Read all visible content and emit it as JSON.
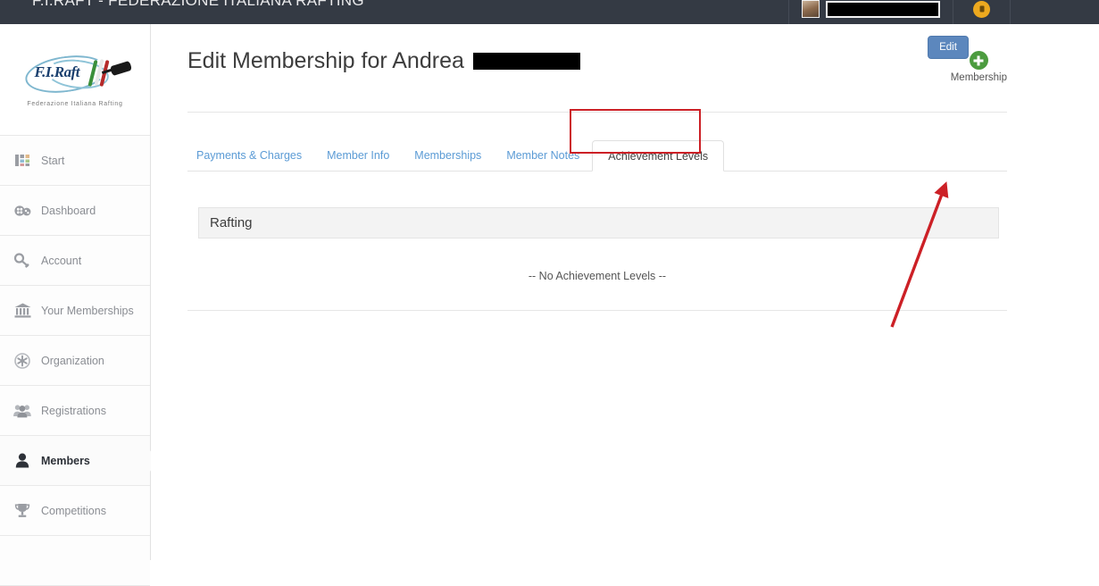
{
  "topbar": {
    "title": "F.I.RAFT - FEDERAZIONE ITALIANA RAFTING",
    "background_color": "#343a44",
    "avatar_icon": "user-avatar-photo",
    "username_redacted": "",
    "notification_icon": "bell-icon",
    "notification_color": "#eda91f"
  },
  "sidebar": {
    "logo": {
      "brand": "F.I.Raft",
      "tagline": "Federazione Italiana Rafting"
    },
    "items": [
      {
        "label": "Start",
        "icon": "grid-icon",
        "active": false
      },
      {
        "label": "Dashboard",
        "icon": "gauge-icon",
        "active": false
      },
      {
        "label": "Account",
        "icon": "key-icon",
        "active": false
      },
      {
        "label": "Your Memberships",
        "icon": "bank-icon",
        "active": false
      },
      {
        "label": "Organization",
        "icon": "asterisk-gear-icon",
        "active": false
      },
      {
        "label": "Registrations",
        "icon": "people-icon",
        "active": false
      },
      {
        "label": "Members",
        "icon": "person-icon",
        "active": true
      },
      {
        "label": "Competitions",
        "icon": "trophy-icon",
        "active": false
      }
    ]
  },
  "main": {
    "page_title": "Edit Membership for Andrea",
    "title_redacted": true,
    "add_membership": {
      "icon": "plus-circle-icon",
      "label": "Membership",
      "color": "#4c9c3f"
    },
    "tabs": [
      {
        "label": "Payments & Charges",
        "active": false
      },
      {
        "label": "Member Info",
        "active": false
      },
      {
        "label": "Memberships",
        "active": false
      },
      {
        "label": "Member Notes",
        "active": false
      },
      {
        "label": "Achievement Levels",
        "active": true
      }
    ],
    "edit_button": {
      "label": "Edit",
      "color": "#5c87bd"
    },
    "panel": {
      "header": "Rafting",
      "empty_message": "-- No Achievement Levels --"
    }
  },
  "annotations": {
    "highlight_color": "#cc2026",
    "highlight_target": "Achievement Levels",
    "arrow_target": "Edit"
  }
}
